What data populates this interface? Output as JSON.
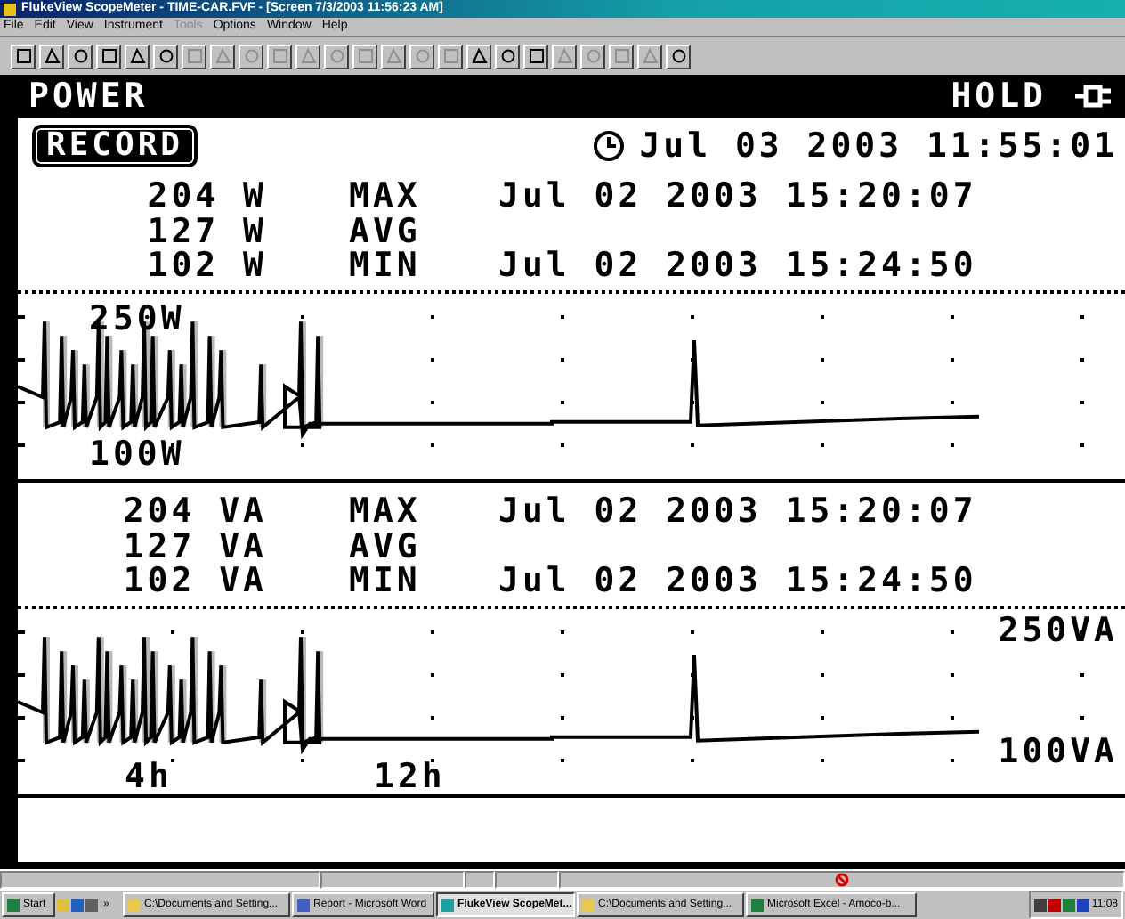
{
  "window": {
    "title": "FlukeView ScopeMeter - TIME-CAR.FVF - [Screen  7/3/2003  11:56:23 AM]"
  },
  "menu": [
    {
      "label": "File",
      "disabled": false
    },
    {
      "label": "Edit",
      "disabled": false
    },
    {
      "label": "View",
      "disabled": false
    },
    {
      "label": "Instrument",
      "disabled": false
    },
    {
      "label": "Tools",
      "disabled": true
    },
    {
      "label": "Options",
      "disabled": false
    },
    {
      "label": "Window",
      "disabled": false
    },
    {
      "label": "Help",
      "disabled": false
    }
  ],
  "toolbar": [
    {
      "disabled": false
    },
    {
      "disabled": false
    },
    {
      "disabled": false
    },
    {
      "disabled": false
    },
    {
      "disabled": false
    },
    {
      "disabled": false
    },
    {
      "disabled": true
    },
    {
      "disabled": true
    },
    {
      "disabled": true
    },
    {
      "disabled": true
    },
    {
      "disabled": true
    },
    {
      "disabled": true
    },
    {
      "disabled": true
    },
    {
      "disabled": true
    },
    {
      "disabled": true
    },
    {
      "disabled": true
    },
    {
      "disabled": false
    },
    {
      "disabled": false
    },
    {
      "disabled": false
    },
    {
      "disabled": true
    },
    {
      "disabled": true
    },
    {
      "disabled": true
    },
    {
      "disabled": true
    },
    {
      "disabled": false
    }
  ],
  "scope": {
    "mode": "POWER",
    "status": "HOLD",
    "record_label": "RECORD",
    "timestamp": "Jul 03 2003 11:55:01",
    "sections": [
      {
        "readings": [
          {
            "value": "204 W",
            "label": "MAX",
            "time": "Jul 02 2003 15:20:07"
          },
          {
            "value": "127 W",
            "label": "AVG"
          },
          {
            "value": "102 W",
            "label": "MIN",
            "time": "Jul 02 2003 15:24:50"
          }
        ],
        "chart": {
          "scale_top": "250W",
          "scale_bottom": "100W"
        }
      },
      {
        "readings": [
          {
            "value": "204 VA",
            "label": "MAX",
            "time": "Jul 02 2003 15:20:07"
          },
          {
            "value": "127 VA",
            "label": "AVG"
          },
          {
            "value": "102 VA",
            "label": "MIN",
            "time": "Jul 02 2003 15:24:50"
          }
        ],
        "chart": {
          "scale_top": "250VA",
          "scale_bottom": "100VA",
          "time_labels": [
            "4h",
            "12h"
          ]
        }
      }
    ]
  },
  "taskbar": {
    "start": "Start",
    "more": "»",
    "tasks": [
      {
        "label": "C:\\Documents and Setting...",
        "selected": false
      },
      {
        "label": "Report - Microsoft Word",
        "selected": false
      },
      {
        "label": "FlukeView ScopeMet...",
        "selected": true
      },
      {
        "label": "C:\\Documents and Setting...",
        "selected": false
      },
      {
        "label": "Microsoft Excel - Amoco-b...",
        "selected": false
      }
    ],
    "clock": "11:08"
  }
}
